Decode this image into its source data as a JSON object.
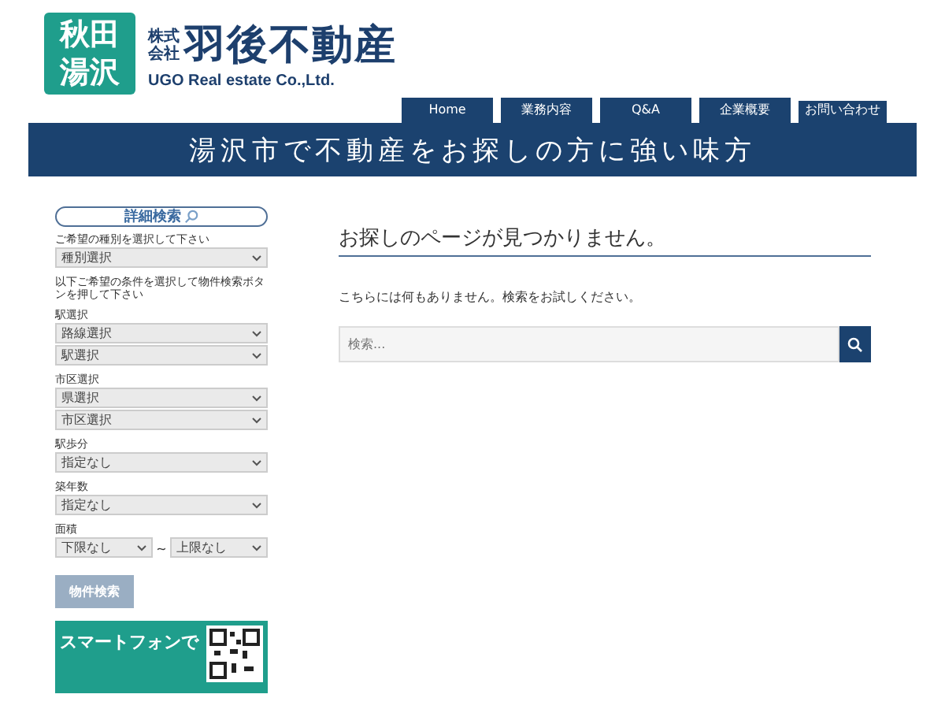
{
  "logo": {
    "badge_lines": [
      "秋田",
      "湯沢"
    ],
    "company_prefix_top": "株式",
    "company_prefix_bottom": "会社",
    "company_name": "羽後不動産",
    "company_english": "UGO Real estate Co.,Ltd."
  },
  "nav": [
    {
      "label": "Home",
      "selected": false
    },
    {
      "label": "業務内容",
      "selected": false
    },
    {
      "label": "Q&A",
      "selected": false
    },
    {
      "label": "企業概要",
      "selected": false
    },
    {
      "label": "お問い合わせ",
      "selected": true
    }
  ],
  "banner": "湯沢市で不動産をお探しの方に強い味方",
  "sidebar": {
    "title": "詳細検索",
    "intro": "ご希望の種別を選択して下さい",
    "groups": [
      {
        "selects": [
          "種別選択"
        ]
      },
      {
        "note": "以下ご希望の条件を選択して物件検索ボタンを押して下さい",
        "label": "駅選択",
        "selects": [
          "路線選択",
          "駅選択"
        ]
      },
      {
        "label": "市区選択",
        "selects": [
          "県選択",
          "市区選択"
        ]
      },
      {
        "label": "駅歩分",
        "selects": [
          "指定なし"
        ]
      },
      {
        "label": "築年数",
        "selects": [
          "指定なし"
        ]
      },
      {
        "label": "面積",
        "range": {
          "from": "下限なし",
          "separator": "~",
          "to": "上限なし"
        }
      }
    ],
    "search_button": "物件検索",
    "promo": "スマートフォンで"
  },
  "main": {
    "heading": "お探しのページが見つかりません。",
    "message": "こちらには何もありません。検索をお試しください。",
    "search": {
      "placeholder": "検索..."
    }
  }
}
